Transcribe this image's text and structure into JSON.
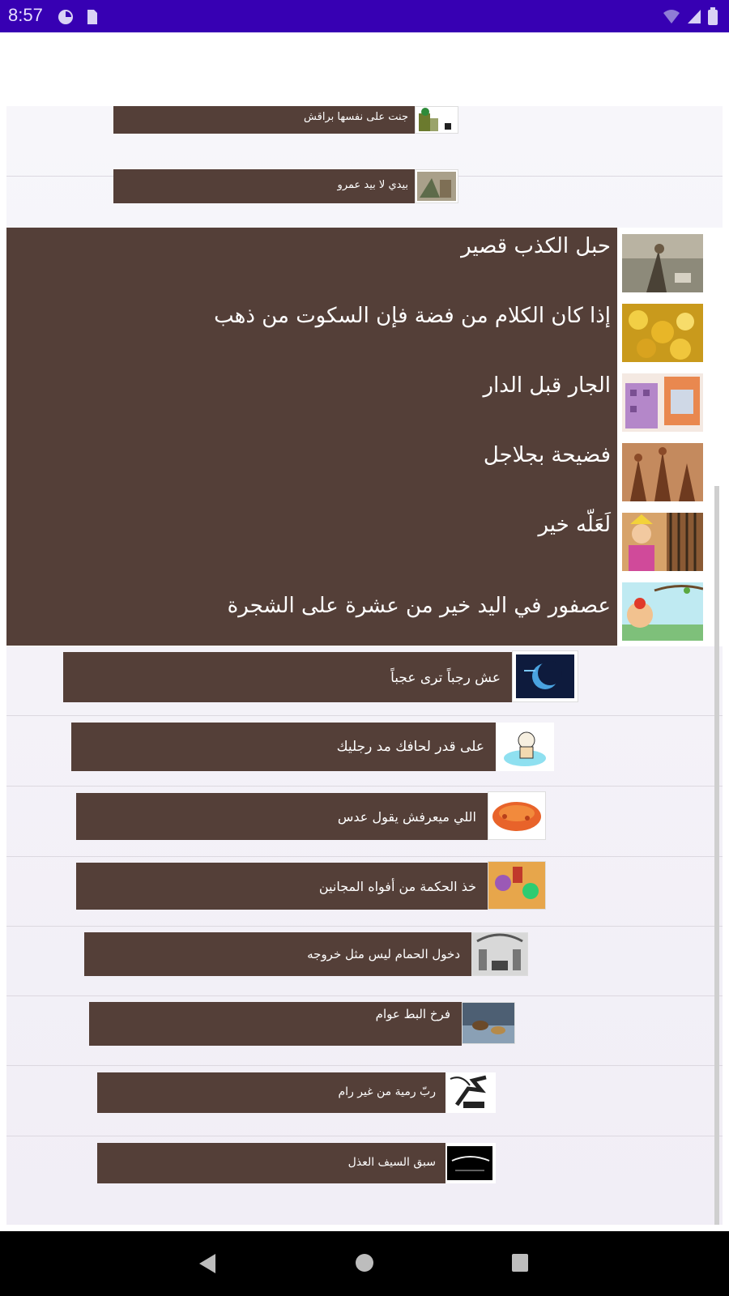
{
  "status_bar": {
    "time": "8:57"
  },
  "colors": {
    "status_bar": "#3700b3",
    "item_background": "#543f38",
    "item_text": "#ffffff"
  },
  "list": {
    "items": [
      {
        "label": "جنت على نفسها  براقش",
        "style": "small",
        "icon": "goat-hut-image"
      },
      {
        "label": "بيدي لا بيد عمرو",
        "style": "small",
        "icon": "warrior-scene-image"
      },
      {
        "label": "حبل الكذب قصير",
        "style": "large",
        "icon": "shepherd-image"
      },
      {
        "label": "إذا كان الكلام من فضة فإن السكوت من ذهب",
        "style": "large",
        "icon": "gold-coins-image"
      },
      {
        "label": "الجار قبل الدار",
        "style": "large",
        "icon": "houses-image"
      },
      {
        "label": "فضيحة بجلاجل",
        "style": "large",
        "icon": "crowd-scene-image"
      },
      {
        "label": "لَعَلّه خير",
        "style": "large",
        "icon": "king-prison-image"
      },
      {
        "label": "عصفور في اليد خير من عشرة على الشجرة",
        "style": "large",
        "icon": "bird-hand-image"
      },
      {
        "label": "عش رجباً ترى عجباً",
        "style": "medium",
        "icon": "crescent-moon-image"
      },
      {
        "label": "على قدر لحافك مد رجليك",
        "style": "medium",
        "icon": "blanket-figure-image"
      },
      {
        "label": "اللي ميعرفش يقول عدس",
        "style": "medium",
        "icon": "lentils-image"
      },
      {
        "label": "خذ الحكمة من أفواه المجانين",
        "style": "medium",
        "icon": "cartoon-characters-image"
      },
      {
        "label": "دخول الحمام ليس مثل خروجه",
        "style": "medium",
        "icon": "bath-house-image"
      },
      {
        "label": "فرخ البط عوام",
        "style": "medium",
        "icon": "ducks-image"
      },
      {
        "label": "ربّ رمية من غير رام",
        "style": "medium",
        "icon": "archer-image"
      },
      {
        "label": "سبق السيف العذل",
        "style": "medium",
        "icon": "sword-calligraphy-image"
      }
    ]
  },
  "nav_bar": {
    "back": "back-icon",
    "home": "home-icon",
    "recents": "recents-icon"
  }
}
